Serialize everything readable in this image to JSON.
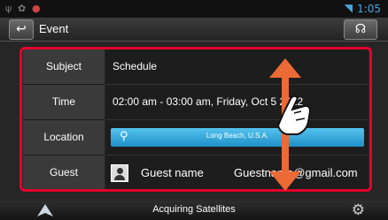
{
  "statusbar": {
    "left_icons": [
      "usb-icon",
      "app-icon",
      "notification-icon"
    ],
    "wifi_icon": "wifi-icon",
    "time": "1:05",
    "accent_color": "#49a7df"
  },
  "header": {
    "back_icon": "back-arrow-icon",
    "title": "Event",
    "voice_icon": "voice-icon"
  },
  "event": {
    "subject_label": "Subject",
    "subject_value": "Schedule",
    "time_label": "Time",
    "time_value": "02:00 am - 03:00 am, Friday, Oct 5 2012",
    "location_label": "Location",
    "location_value": "Long Beach, U.S.A.",
    "guest_label": "Guest",
    "guest_name": "Guest name",
    "guest_email": "Guestname@gmail.com"
  },
  "bottom": {
    "status": "Acquiring Satellites",
    "left_icon": "navigation-icon",
    "right_icon": "settings-gear-icon"
  },
  "annotation": {
    "highlight_color": "#e4002b",
    "gesture": "scroll-up-down"
  }
}
